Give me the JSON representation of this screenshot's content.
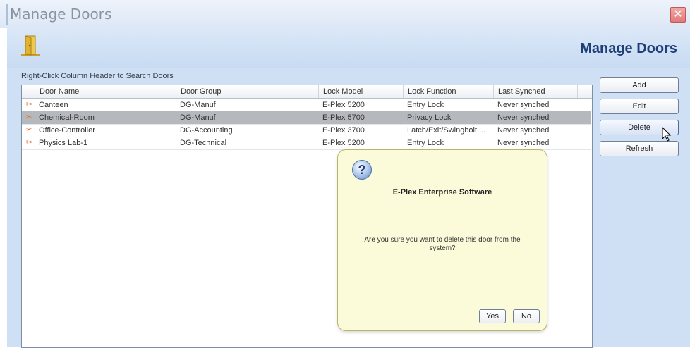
{
  "window": {
    "title": "Manage Doors",
    "close_glyph": "✕"
  },
  "header": {
    "title": "Manage Doors",
    "icon": "door-icon"
  },
  "grid": {
    "hint": "Right-Click Column Header to Search Doors",
    "columns": [
      "Door Name",
      "Door Group",
      "Lock Model",
      "Lock Function",
      "Last Synched"
    ],
    "rows": [
      {
        "name": "Canteen",
        "group": "DG-Manuf",
        "model": "E-Plex 5200",
        "function": "Entry Lock",
        "synched": "Never synched",
        "selected": false
      },
      {
        "name": "Chemical-Room",
        "group": "DG-Manuf",
        "model": "E-Plex 5700",
        "function": "Privacy Lock",
        "synched": "Never synched",
        "selected": true
      },
      {
        "name": "Office-Controller",
        "group": "DG-Accounting",
        "model": "E-Plex 3700",
        "function": "Latch/Exit/Swingbolt ...",
        "synched": "Never synched",
        "selected": false
      },
      {
        "name": "Physics Lab-1",
        "group": "DG-Technical",
        "model": "E-Plex 5200",
        "function": "Entry Lock",
        "synched": "Never synched",
        "selected": false
      }
    ]
  },
  "actions": {
    "add": "Add",
    "edit": "Edit",
    "delete": "Delete",
    "refresh": "Refresh"
  },
  "dialog": {
    "title": "E-Plex Enterprise Software",
    "message": "Are you sure you want to delete this door from the system?",
    "yes": "Yes",
    "no": "No",
    "icon_glyph": "?"
  },
  "colors": {
    "accent": "#1f3f78",
    "selected_row": "#b5b8bc",
    "panel": "#cfdff4",
    "dialog_bg": "#fbfbda"
  }
}
